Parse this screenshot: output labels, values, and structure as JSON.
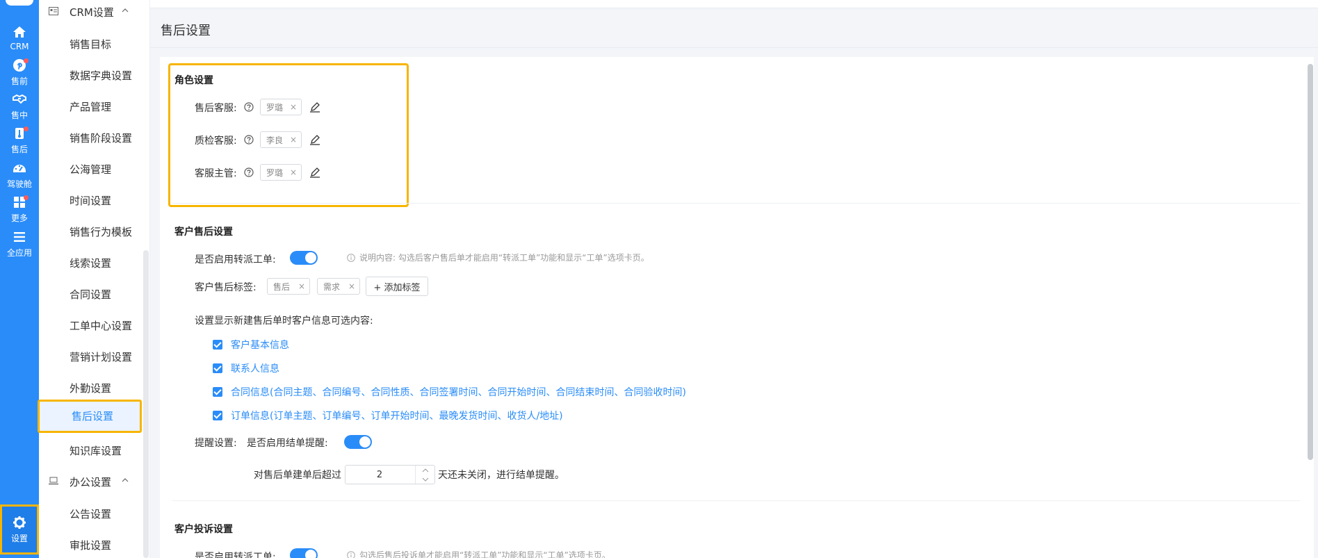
{
  "rail": {
    "items": [
      {
        "label": "CRM",
        "icon": "home-icon",
        "dot": false
      },
      {
        "label": "售前",
        "icon": "pinterest-icon",
        "dot": true
      },
      {
        "label": "售中",
        "icon": "handshake-icon",
        "dot": false
      },
      {
        "label": "售后",
        "icon": "thermometer-icon",
        "dot": true
      },
      {
        "label": "驾驶舱",
        "icon": "dashboard-icon",
        "dot": false
      },
      {
        "label": "更多",
        "icon": "grid-icon",
        "dot": true
      },
      {
        "label": "全应用",
        "icon": "menu-icon",
        "dot": false
      },
      {
        "label": "设置",
        "icon": "gear-icon",
        "dot": false
      }
    ]
  },
  "submenu": {
    "crm_group": "CRM设置",
    "crm_items": [
      "销售目标",
      "数据字典设置",
      "产品管理",
      "销售阶段设置",
      "公海管理",
      "时间设置",
      "销售行为模板",
      "线索设置",
      "合同设置",
      "工单中心设置",
      "营销计划设置",
      "外勤设置",
      "售后设置",
      "知识库设置"
    ],
    "office_group": "办公设置",
    "office_items": [
      "公告设置",
      "审批设置"
    ]
  },
  "page": {
    "title": "售后设置"
  },
  "roles": {
    "title": "角色设置",
    "rows": [
      {
        "label": "售后客服:",
        "tag": "罗璐"
      },
      {
        "label": "质检客服:",
        "tag": "李良"
      },
      {
        "label": "客服主管:",
        "tag": "罗璐"
      }
    ]
  },
  "customer_after_sales": {
    "title": "客户售后设置",
    "enable_label": "是否启用转派工单:",
    "enable_hint": "说明内容: 勾选后客户售后单才能启用“转派工单”功能和显示“工单”选项卡页。",
    "tags_label": "客户售后标签:",
    "tags": [
      "售后",
      "需求"
    ],
    "add_tag": "+ 添加标签",
    "options_label": "设置显示新建售后单时客户信息可选内容:",
    "options": [
      "客户基本信息",
      "联系人信息",
      "合同信息(合同主题、合同编号、合同性质、合同签署时间、合同开始时间、合同结束时间、合同验收时间)",
      "订单信息(订单主题、订单编号、订单开始时间、最晚发货时间、收货人/地址)"
    ],
    "remind_label": "提醒设置:",
    "remind_enable_label": "是否启用结单提醒:",
    "remind_prefix": "对售后单建单后超过",
    "remind_days": "2",
    "remind_suffix": "天还未关闭，进行结单提醒。"
  },
  "complaint": {
    "title": "客户投诉设置",
    "enable_label": "是否启用转派工单:",
    "enable_hint": "勾选后售后投诉单才能启用“转派工单”功能和显示“工单”选项卡页。"
  },
  "colors": {
    "primary": "#2a8cf8",
    "highlight": "#f7b500",
    "badge": "#ff5b5b"
  }
}
